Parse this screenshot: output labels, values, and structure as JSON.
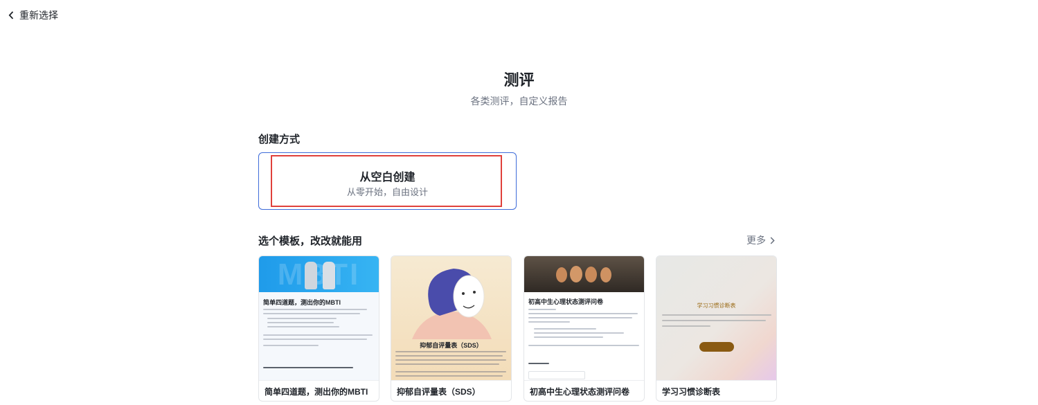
{
  "nav": {
    "back_label": "重新选择"
  },
  "header": {
    "title": "测评",
    "subtitle": "各类测评，自定义报告"
  },
  "create": {
    "section_label": "创建方式",
    "blank_title": "从空白创建",
    "blank_subtitle": "从零开始，自由设计"
  },
  "templates": {
    "section_label": "选个模板，改改就能用",
    "more_label": "更多",
    "items": [
      {
        "label": "简单四道题，测出你的MBTI",
        "thumb_title": "简单四道题，测出你的MBTI",
        "thumb_banner": "MBTI"
      },
      {
        "label": "抑郁自评量表（SDS）",
        "thumb_title": "抑郁自评量表（SDS）"
      },
      {
        "label": "初高中生心理状态测评问卷",
        "thumb_title": "初高中生心理状态测评问卷"
      },
      {
        "label": "学习习惯诊断表",
        "thumb_title": "学习习惯诊断表"
      }
    ]
  },
  "colors": {
    "accent": "#3d6bd9",
    "highlight": "#e0403a",
    "muted": "#6b7280"
  }
}
